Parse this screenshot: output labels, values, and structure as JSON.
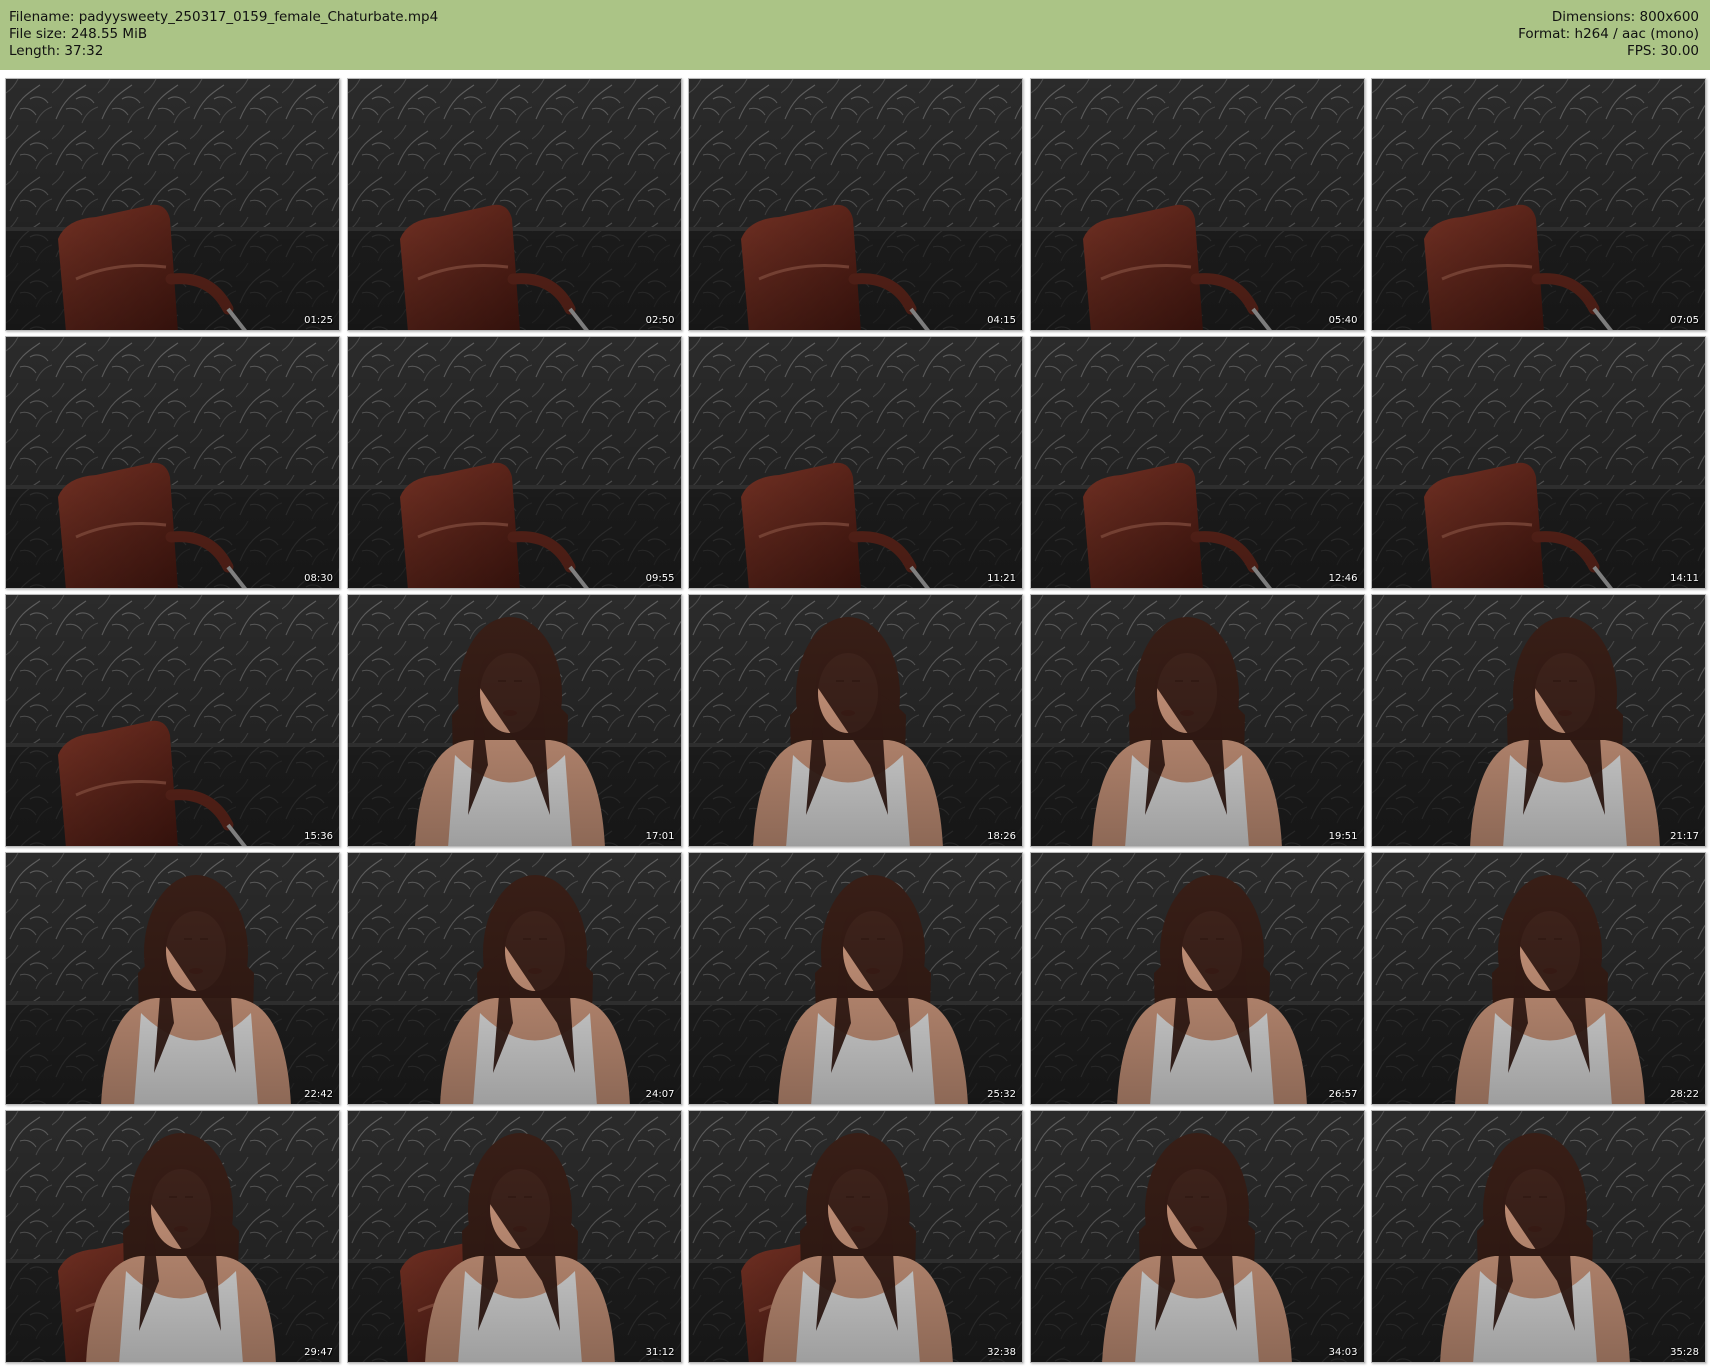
{
  "header": {
    "filename": "Filename: padyysweety_250317_0159_female_Chaturbate.mp4",
    "filesize": "File size: 248.55 MiB",
    "length": "Length: 37:32",
    "dimensions": "Dimensions: 800x600",
    "format": "Format: h264 / aac (mono)",
    "fps": "FPS: 30.00"
  },
  "colors": {
    "header_bg": "#abc486",
    "wallpaper": "#2b2b2b",
    "chair": "#6b2a1e",
    "hair": "#3a1f17",
    "skin": "#d8a084",
    "top": "#f2f2f2",
    "lips": "#c2262e"
  },
  "thumbnails": [
    {
      "time": "01:25",
      "scene": "chair"
    },
    {
      "time": "02:50",
      "scene": "chair"
    },
    {
      "time": "04:15",
      "scene": "chair"
    },
    {
      "time": "05:40",
      "scene": "chair"
    },
    {
      "time": "07:05",
      "scene": "chair"
    },
    {
      "time": "08:30",
      "scene": "chair"
    },
    {
      "time": "09:55",
      "scene": "chair"
    },
    {
      "time": "11:21",
      "scene": "chair"
    },
    {
      "time": "12:46",
      "scene": "chair"
    },
    {
      "time": "14:11",
      "scene": "chair"
    },
    {
      "time": "15:36",
      "scene": "chair"
    },
    {
      "time": "17:01",
      "scene": "person"
    },
    {
      "time": "18:26",
      "scene": "person"
    },
    {
      "time": "19:51",
      "scene": "person"
    },
    {
      "time": "21:17",
      "scene": "person"
    },
    {
      "time": "22:42",
      "scene": "person"
    },
    {
      "time": "24:07",
      "scene": "person"
    },
    {
      "time": "25:32",
      "scene": "person"
    },
    {
      "time": "26:57",
      "scene": "person"
    },
    {
      "time": "28:22",
      "scene": "person"
    },
    {
      "time": "29:47",
      "scene": "person"
    },
    {
      "time": "31:12",
      "scene": "person"
    },
    {
      "time": "32:38",
      "scene": "person"
    },
    {
      "time": "34:03",
      "scene": "person"
    },
    {
      "time": "35:28",
      "scene": "person"
    }
  ]
}
